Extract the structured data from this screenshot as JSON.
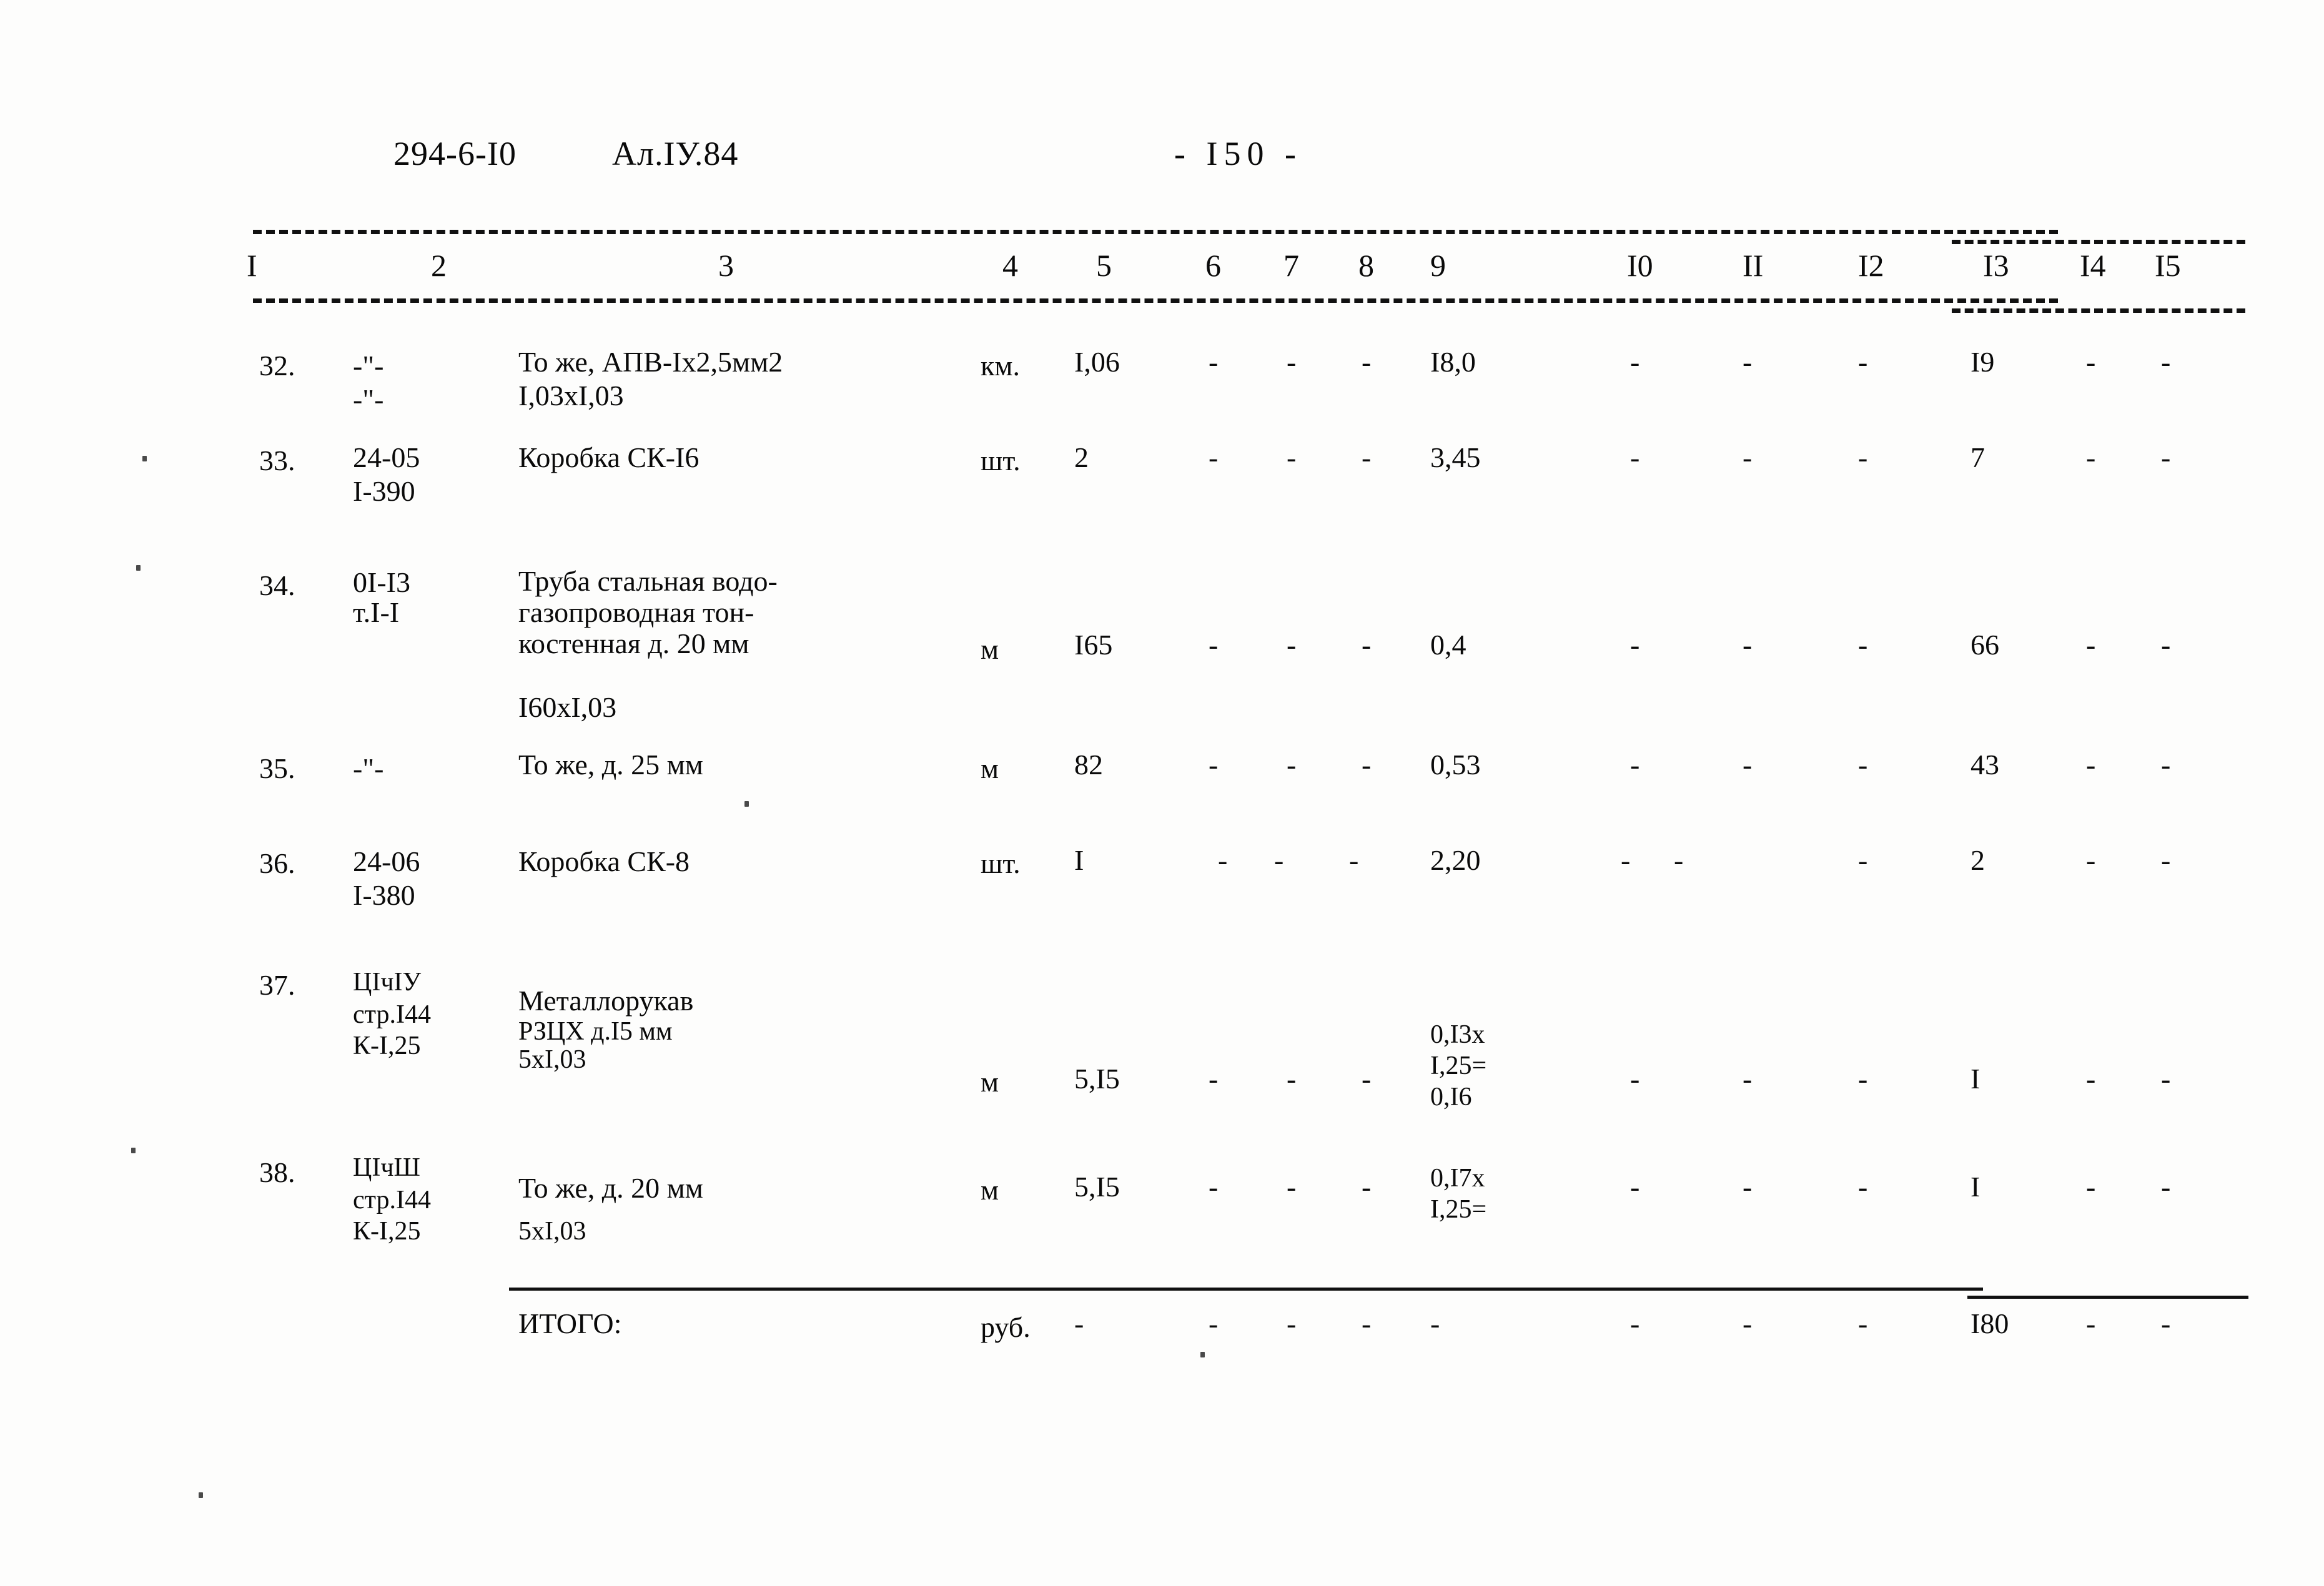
{
  "header": {
    "doc_code": "294-6-I0",
    "album": "Ал.IУ.84",
    "page_marker": "-  I50   -"
  },
  "table": {
    "column_headers": [
      "I",
      "2",
      "3",
      "4",
      "5",
      "6",
      "7",
      "8",
      "9",
      "I0",
      "II",
      "I2",
      "I3",
      "I4",
      "I5"
    ],
    "rows": [
      {
        "num": "32.",
        "code": "-\"-",
        "code2": "-\"-",
        "name": "То же, АПВ-Ix2,5мм2",
        "name2": "I,03xI,03",
        "unit": "км.",
        "qty": "I,06",
        "c6": "-",
        "c7": "-",
        "c8": "-",
        "c9": "I8,0",
        "c10": "-",
        "c11": "-",
        "c12": "-",
        "c13": "I9",
        "c14": "-",
        "c15": "-"
      },
      {
        "num": "33.",
        "code": "24-05",
        "code2": "I-390",
        "name": "Коробка СК-I6",
        "name2": "",
        "unit": "шт.",
        "qty": "2",
        "c6": "-",
        "c7": "-",
        "c8": "-",
        "c9": "3,45",
        "c10": "-",
        "c11": "-",
        "c12": "-",
        "c13": "7",
        "c14": "-",
        "c15": "-"
      },
      {
        "num": "34.",
        "code": "0I-I3",
        "code2": "т.I-I",
        "name": "Труба стальная водо-",
        "name_l2": "газопроводная тон-",
        "name_l3": "костенная д. 20 мм",
        "name2": "I60xI,03",
        "unit": "м",
        "qty": "I65",
        "c6": "-",
        "c7": "-",
        "c8": "-",
        "c9": "0,4",
        "c10": "-",
        "c11": "-",
        "c12": "-",
        "c13": "66",
        "c14": "-",
        "c15": "-"
      },
      {
        "num": "35.",
        "code": "-\"-",
        "code2": "",
        "name": "То же, д. 25 мм",
        "name2": "",
        "unit": "м",
        "qty": "82",
        "c6": "-",
        "c7": "-",
        "c8": "-",
        "c9": "0,53",
        "c10": "-",
        "c11": "-",
        "c12": "-",
        "c13": "43",
        "c14": "-",
        "c15": "-"
      },
      {
        "num": "36.",
        "code": "24-06",
        "code2": "I-380",
        "name": "Коробка СК-8",
        "name2": "",
        "unit": "шт.",
        "qty": "I",
        "c6": "-",
        "c7": "-",
        "c8": "-",
        "c9": "2,20",
        "c10": "-",
        "c11": "-",
        "c12": "-",
        "c13": "2",
        "c14": "-",
        "c15": "-"
      },
      {
        "num": "37.",
        "code": "ЦIчIУ",
        "code2": "стр.I44",
        "code3": "К-I,25",
        "name": "Металлорукав",
        "name_l2": "РЗЦХ д.I5 мм",
        "name_l3": "5xI,03",
        "unit": "м",
        "qty": "5,I5",
        "c6": "-",
        "c7": "-",
        "c8": "-",
        "c9": "0,I3x",
        "c9_l2": "I,25=",
        "c9_l3": "0,I6",
        "c10": "-",
        "c11": "-",
        "c12": "-",
        "c13": "I",
        "c14": "-",
        "c15": "-"
      },
      {
        "num": "38.",
        "code": "ЦIчШ",
        "code2": "стр.I44",
        "code3": "К-I,25",
        "name": "То же, д. 20 мм",
        "name_l2": "5xI,03",
        "unit": "м",
        "qty": "5,I5",
        "c6": "-",
        "c7": "-",
        "c8": "-",
        "c9": "0,I7x",
        "c9_l2": "I,25=",
        "c10": "-",
        "c11": "-",
        "c12": "-",
        "c13": "I",
        "c14": "-",
        "c15": "-"
      }
    ],
    "total_row": {
      "label": "ИТОГО:",
      "unit": "руб.",
      "c5": "-",
      "c6": "-",
      "c7": "-",
      "c8": "-",
      "c9": "-",
      "c10": "-",
      "c11": "-",
      "c12": "-",
      "c13": "I80",
      "c14": "-",
      "c15": "-"
    }
  }
}
